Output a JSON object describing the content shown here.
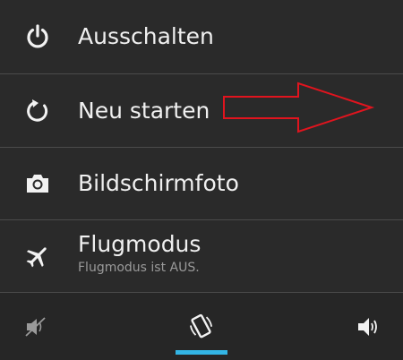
{
  "menu": {
    "items": [
      {
        "label": "Ausschalten",
        "icon": "power-icon"
      },
      {
        "label": "Neu starten",
        "icon": "restart-icon"
      },
      {
        "label": "Bildschirmfoto",
        "icon": "camera-icon"
      },
      {
        "label": "Flugmodus",
        "sublabel": "Flugmodus ist AUS.",
        "icon": "airplane-icon"
      }
    ]
  },
  "sound_modes": {
    "options": [
      "mute",
      "vibrate",
      "sound"
    ],
    "selected": "vibrate",
    "accent_color": "#33b5e5"
  },
  "annotation": {
    "shape": "arrow",
    "color": "#e0141e"
  }
}
